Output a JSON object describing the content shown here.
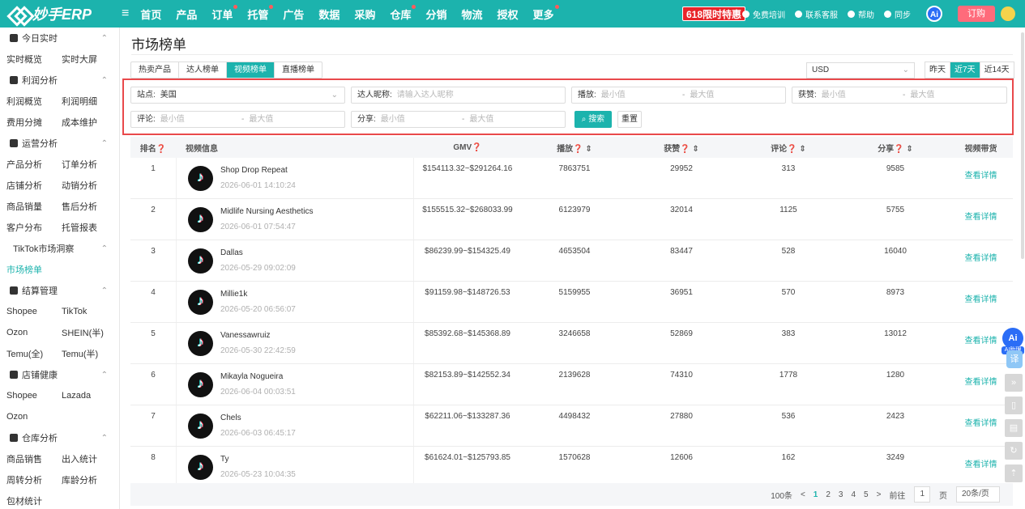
{
  "topbar": {
    "logo": "妙手ERP",
    "nav": [
      {
        "label": "首页",
        "dot": false
      },
      {
        "label": "产品",
        "dot": false
      },
      {
        "label": "订单",
        "dot": true
      },
      {
        "label": "托管",
        "dot": true
      },
      {
        "label": "广告",
        "dot": false
      },
      {
        "label": "数据",
        "dot": false
      },
      {
        "label": "采购",
        "dot": false
      },
      {
        "label": "仓库",
        "dot": true
      },
      {
        "label": "分销",
        "dot": false
      },
      {
        "label": "物流",
        "dot": false
      },
      {
        "label": "授权",
        "dot": false
      },
      {
        "label": "更多",
        "dot": true
      }
    ],
    "promo": "618限时特惠",
    "tools": [
      "免费培训",
      "联系客服",
      "帮助",
      "同步"
    ],
    "ai": "Ai",
    "order": "订购"
  },
  "sidebar": {
    "sections": [
      {
        "title": "今日实时",
        "icon": "realtime-icon",
        "items": [
          [
            "实时概览",
            "实时大屏"
          ]
        ]
      },
      {
        "title": "利润分析",
        "icon": "profit-icon",
        "items": [
          [
            "利润概览",
            "利润明细"
          ],
          [
            "费用分摊",
            "成本维护"
          ]
        ]
      },
      {
        "title": "运营分析",
        "icon": "bar-chart-icon",
        "items": [
          [
            "产品分析",
            "订单分析"
          ],
          [
            "店铺分析",
            "动销分析"
          ],
          [
            "商品销量",
            "售后分析"
          ],
          [
            "客户分布",
            "托管报表"
          ]
        ]
      },
      {
        "title": "TikTok市场洞察",
        "icon": "",
        "items": [
          [
            "市场榜单",
            ""
          ]
        ]
      },
      {
        "title": "结算管理",
        "icon": "bar-chart-icon",
        "items": [
          [
            "Shopee",
            "TikTok"
          ],
          [
            "Ozon",
            "SHEIN(半)"
          ],
          [
            "Temu(全)",
            "Temu(半)"
          ]
        ]
      },
      {
        "title": "店铺健康",
        "icon": "store-icon",
        "items": [
          [
            "Shopee",
            "Lazada"
          ],
          [
            "Ozon",
            ""
          ]
        ]
      },
      {
        "title": "仓库分析",
        "icon": "warehouse-icon",
        "items": [
          [
            "商品销售",
            "出入统计"
          ],
          [
            "周转分析",
            "库龄分析"
          ],
          [
            "包材统计",
            ""
          ]
        ]
      }
    ],
    "active": "市场榜单"
  },
  "main": {
    "title": "市场榜单",
    "tabs": [
      {
        "label": "热卖产品",
        "on": false
      },
      {
        "label": "达人榜单",
        "on": false
      },
      {
        "label": "视频榜单",
        "on": true
      },
      {
        "label": "直播榜单",
        "on": false
      }
    ],
    "currency": "USD",
    "ranges": [
      {
        "label": "昨天",
        "on": false
      },
      {
        "label": "近7天",
        "on": true
      },
      {
        "label": "近14天",
        "on": false
      }
    ],
    "filters": {
      "site_label": "站点:",
      "site_value": "美国",
      "nick_label": "达人昵称:",
      "nick_placeholder": "请输入达人昵称",
      "play_label": "播放:",
      "like_label": "获赞:",
      "comment_label": "评论:",
      "share_label": "分享:",
      "min": "最小值",
      "max": "最大值",
      "dash": "-",
      "search": "搜索",
      "reset": "重置"
    },
    "columns": {
      "rank": "排名",
      "info": "视频信息",
      "gmv": "GMV",
      "play": "播放",
      "like": "获赞",
      "comment": "评论",
      "share": "分享",
      "action": "视频带货"
    },
    "rows": [
      {
        "rank": "1",
        "name": "Shop Drop Repeat",
        "time": "2026-06-01 14:10:24",
        "gmv": "$154113.32~$291264.16",
        "play": "7863751",
        "like": "29952",
        "comment": "313",
        "share": "9585",
        "action": "查看详情"
      },
      {
        "rank": "2",
        "name": "Midlife Nursing Aesthetics",
        "time": "2026-06-01 07:54:47",
        "gmv": "$155515.32~$268033.99",
        "play": "6123979",
        "like": "32014",
        "comment": "1125",
        "share": "5755",
        "action": "查看详情"
      },
      {
        "rank": "3",
        "name": "Dallas",
        "time": "2026-05-29 09:02:09",
        "gmv": "$86239.99~$154325.49",
        "play": "4653504",
        "like": "83447",
        "comment": "528",
        "share": "16040",
        "action": "查看详情"
      },
      {
        "rank": "4",
        "name": "Millie1k",
        "time": "2026-05-20 06:56:07",
        "gmv": "$91159.98~$148726.53",
        "play": "5159955",
        "like": "36951",
        "comment": "570",
        "share": "8973",
        "action": "查看详情"
      },
      {
        "rank": "5",
        "name": "Vanessawruiz",
        "time": "2026-05-30 22:42:59",
        "gmv": "$85392.68~$145368.89",
        "play": "3246658",
        "like": "52869",
        "comment": "383",
        "share": "13012",
        "action": "查看详情"
      },
      {
        "rank": "6",
        "name": "Mikayla Nogueira",
        "time": "2026-06-04 00:03:51",
        "gmv": "$82153.89~$142552.34",
        "play": "2139628",
        "like": "74310",
        "comment": "1778",
        "share": "1280",
        "action": "查看详情"
      },
      {
        "rank": "7",
        "name": "Chels",
        "time": "2026-06-03 06:45:17",
        "gmv": "$62211.06~$133287.36",
        "play": "4498432",
        "like": "27880",
        "comment": "536",
        "share": "2423",
        "action": "查看详情"
      },
      {
        "rank": "8",
        "name": "Ty",
        "time": "2026-05-23 10:04:35",
        "gmv": "$61624.01~$125793.85",
        "play": "1570628",
        "like": "12606",
        "comment": "162",
        "share": "3249",
        "action": "查看详情"
      }
    ],
    "pager": {
      "total": "100条",
      "prev": "<",
      "pages": [
        "1",
        "2",
        "3",
        "4",
        "5"
      ],
      "current": "1",
      "next": ">",
      "goto": "前往",
      "page_input": "1",
      "page_unit": "页",
      "page_size": "20条/页"
    }
  },
  "floats": {
    "ai": "Ai",
    "ai_tag": "AI助理",
    "translate": "译"
  }
}
